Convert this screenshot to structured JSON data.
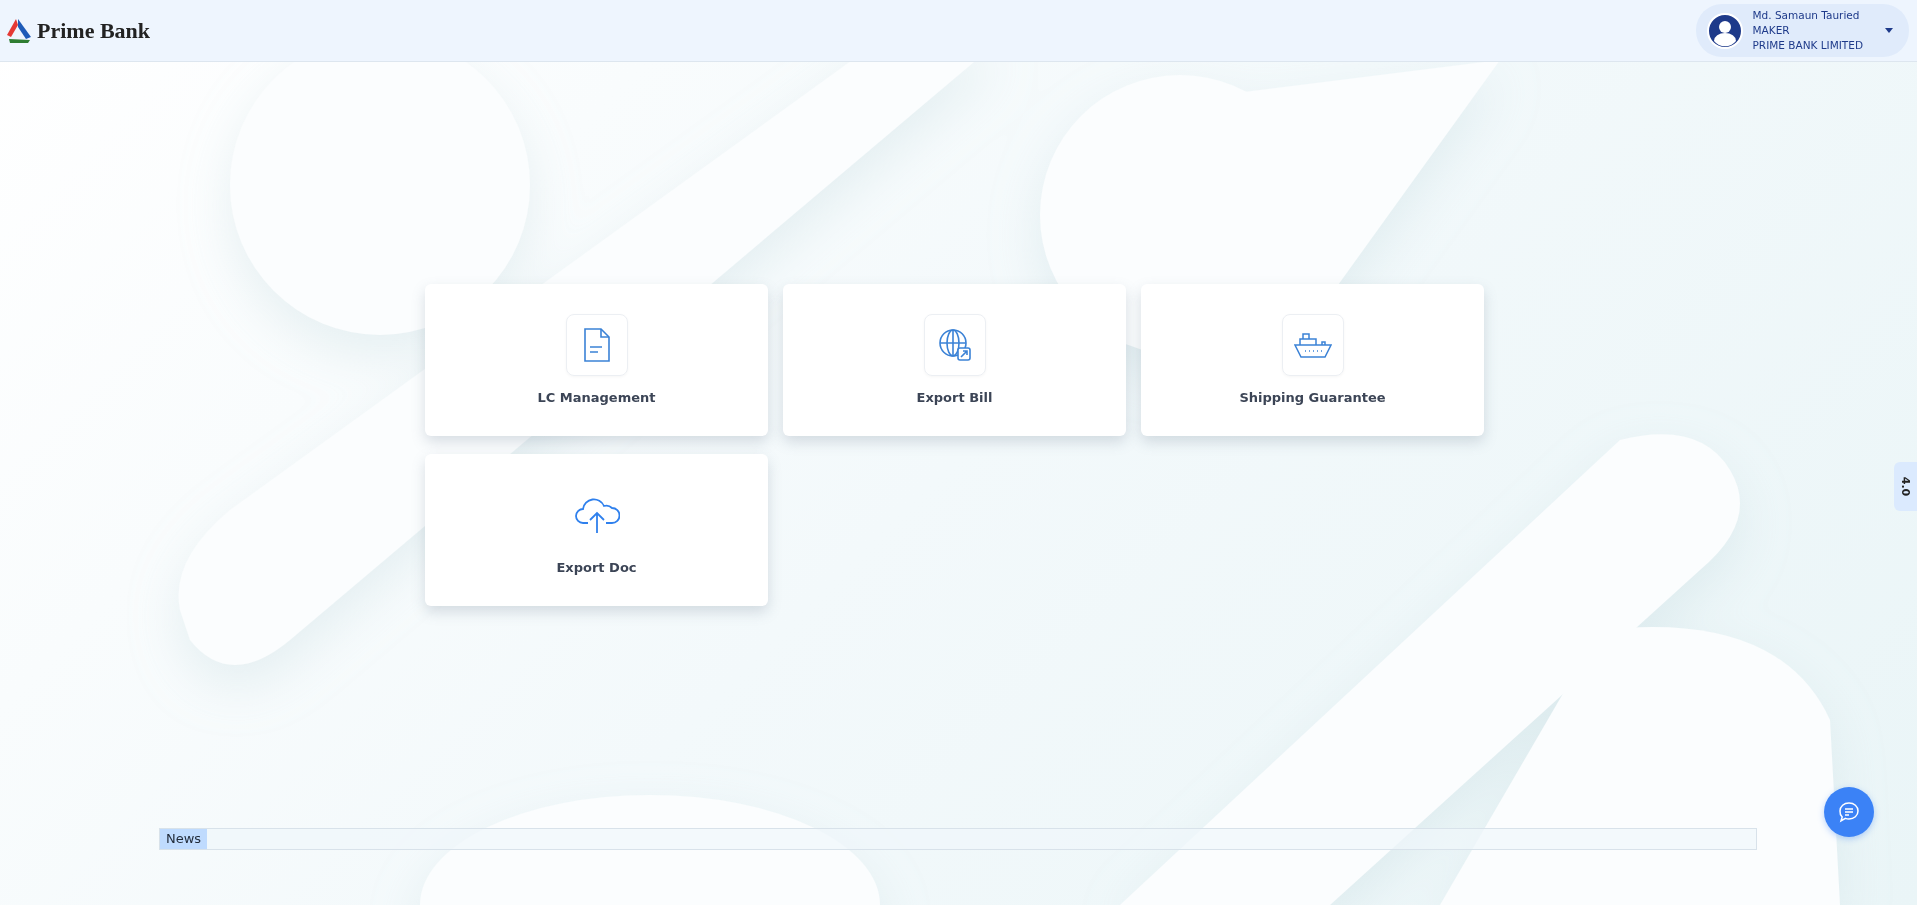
{
  "header": {
    "brand": "Prime Bank",
    "user": {
      "name": "Md. Samaun Tauried",
      "role": "MAKER",
      "organization": "PRIME BANK LIMITED"
    }
  },
  "tiles": [
    {
      "label": "LC Management"
    },
    {
      "label": "Export Bill"
    },
    {
      "label": "Shipping Guarantee"
    },
    {
      "label": "Export Doc"
    }
  ],
  "news": {
    "label": "News"
  },
  "version_tab": "4.0"
}
